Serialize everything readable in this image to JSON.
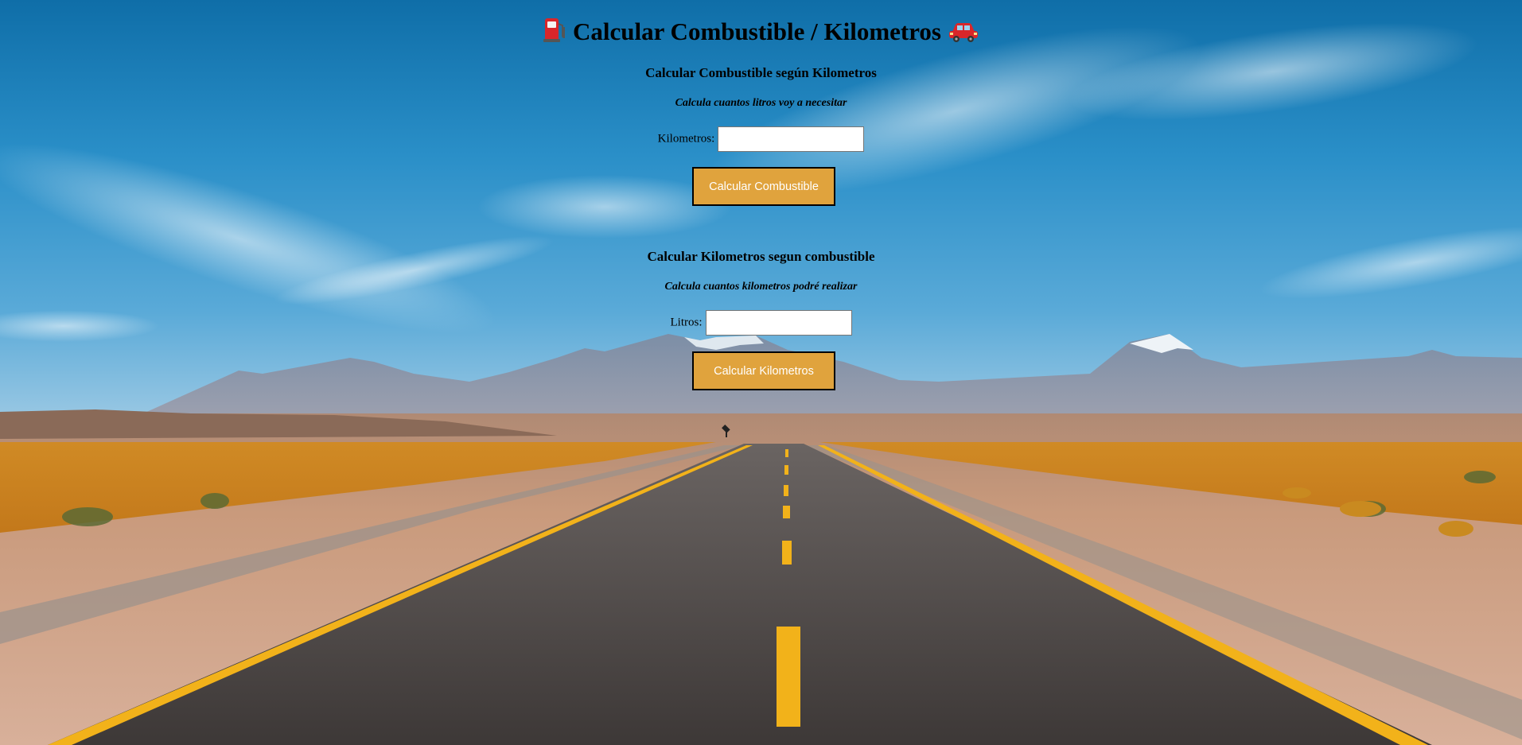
{
  "header": {
    "title": "Calcular Combustible / Kilometros",
    "left_icon": "fuel-pump-icon",
    "right_icon": "car-icon"
  },
  "fuel_section": {
    "heading": "Calcular Combustible según Kilometros",
    "subtitle": "Calcula cuantos litros voy a necesitar",
    "field_label": "Kilometros:",
    "field_value": "",
    "button_label": "Calcular Combustible"
  },
  "km_section": {
    "heading": "Calcular Kilometros segun combustible",
    "subtitle": "Calcula cuantos kilometros podré realizar",
    "field_label": "Litros:",
    "field_value": "",
    "button_label": "Calcular Kilometros"
  },
  "colors": {
    "button_bg": "#e0a33d",
    "button_text": "#ffffff",
    "sky": "#1f86c4"
  }
}
